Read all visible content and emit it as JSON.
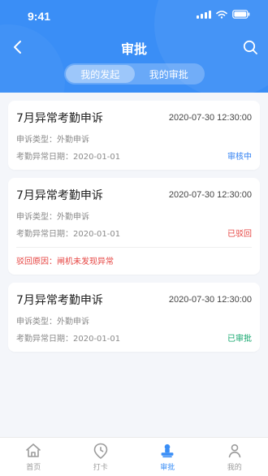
{
  "status_bar": {
    "time": "9:41"
  },
  "header": {
    "title": "审批",
    "back_icon": "chevron-left-icon",
    "search_icon": "search-icon",
    "bg_color": "#3a8ef6",
    "segmented": [
      {
        "label": "我的发起",
        "active": true
      },
      {
        "label": "我的审批",
        "active": false
      }
    ]
  },
  "list": [
    {
      "title": "7月异常考勤申诉",
      "datetime": "2020-07-30 12:30:00",
      "type_label": "申诉类型：外勤申诉",
      "date_label": "考勤异常日期：2020-01-01",
      "status": "审核中",
      "status_color": "#2f7ff2",
      "reject_reason": ""
    },
    {
      "title": "7月异常考勤申诉",
      "datetime": "2020-07-30 12:30:00",
      "type_label": "申诉类型：外勤申诉",
      "date_label": "考勤异常日期：2020-01-01",
      "status": "已驳回",
      "status_color": "#e64340",
      "reject_reason": "驳回原因：闸机未发现异常"
    },
    {
      "title": "7月异常考勤申诉",
      "datetime": "2020-07-30 12:30:00",
      "type_label": "申诉类型：外勤申诉",
      "date_label": "考勤异常日期：2020-01-01",
      "status": "已审批",
      "status_color": "#10a56b",
      "reject_reason": ""
    }
  ],
  "bottom_nav": [
    {
      "label": "首页",
      "icon": "home-icon",
      "active": false
    },
    {
      "label": "打卡",
      "icon": "clock-pin-icon",
      "active": false
    },
    {
      "label": "审批",
      "icon": "stamp-icon",
      "active": true
    },
    {
      "label": "我的",
      "icon": "user-icon",
      "active": false
    }
  ],
  "colors": {
    "accent": "#3a8ef6",
    "page_bg": "#f4f6fa"
  }
}
